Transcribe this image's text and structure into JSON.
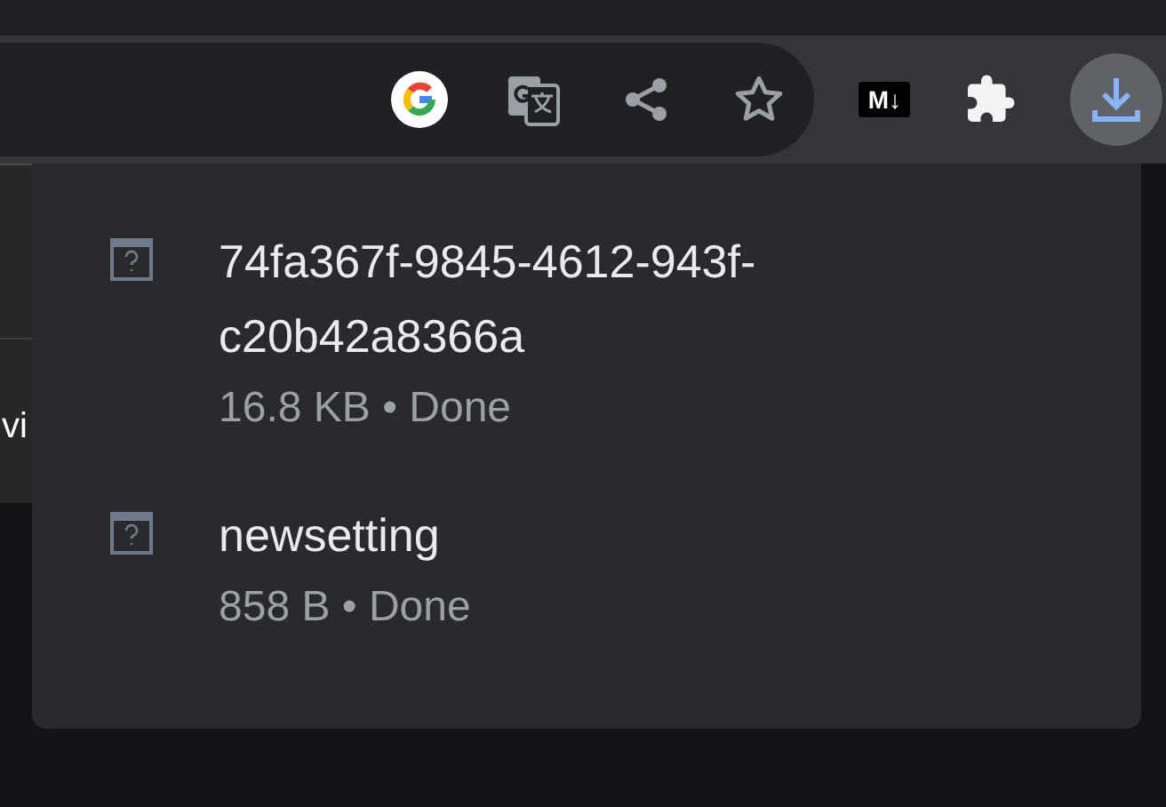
{
  "toolbar": {
    "markdown_badge": "M↓",
    "download_button": {
      "selected": true
    }
  },
  "page": {
    "cut_text": "vi"
  },
  "downloads": [
    {
      "name": "74fa367f-9845-4612-943f-c20b42a8366a",
      "meta": "16.8 KB • Done"
    },
    {
      "name": "newsetting",
      "meta": "858 B • Done"
    }
  ]
}
